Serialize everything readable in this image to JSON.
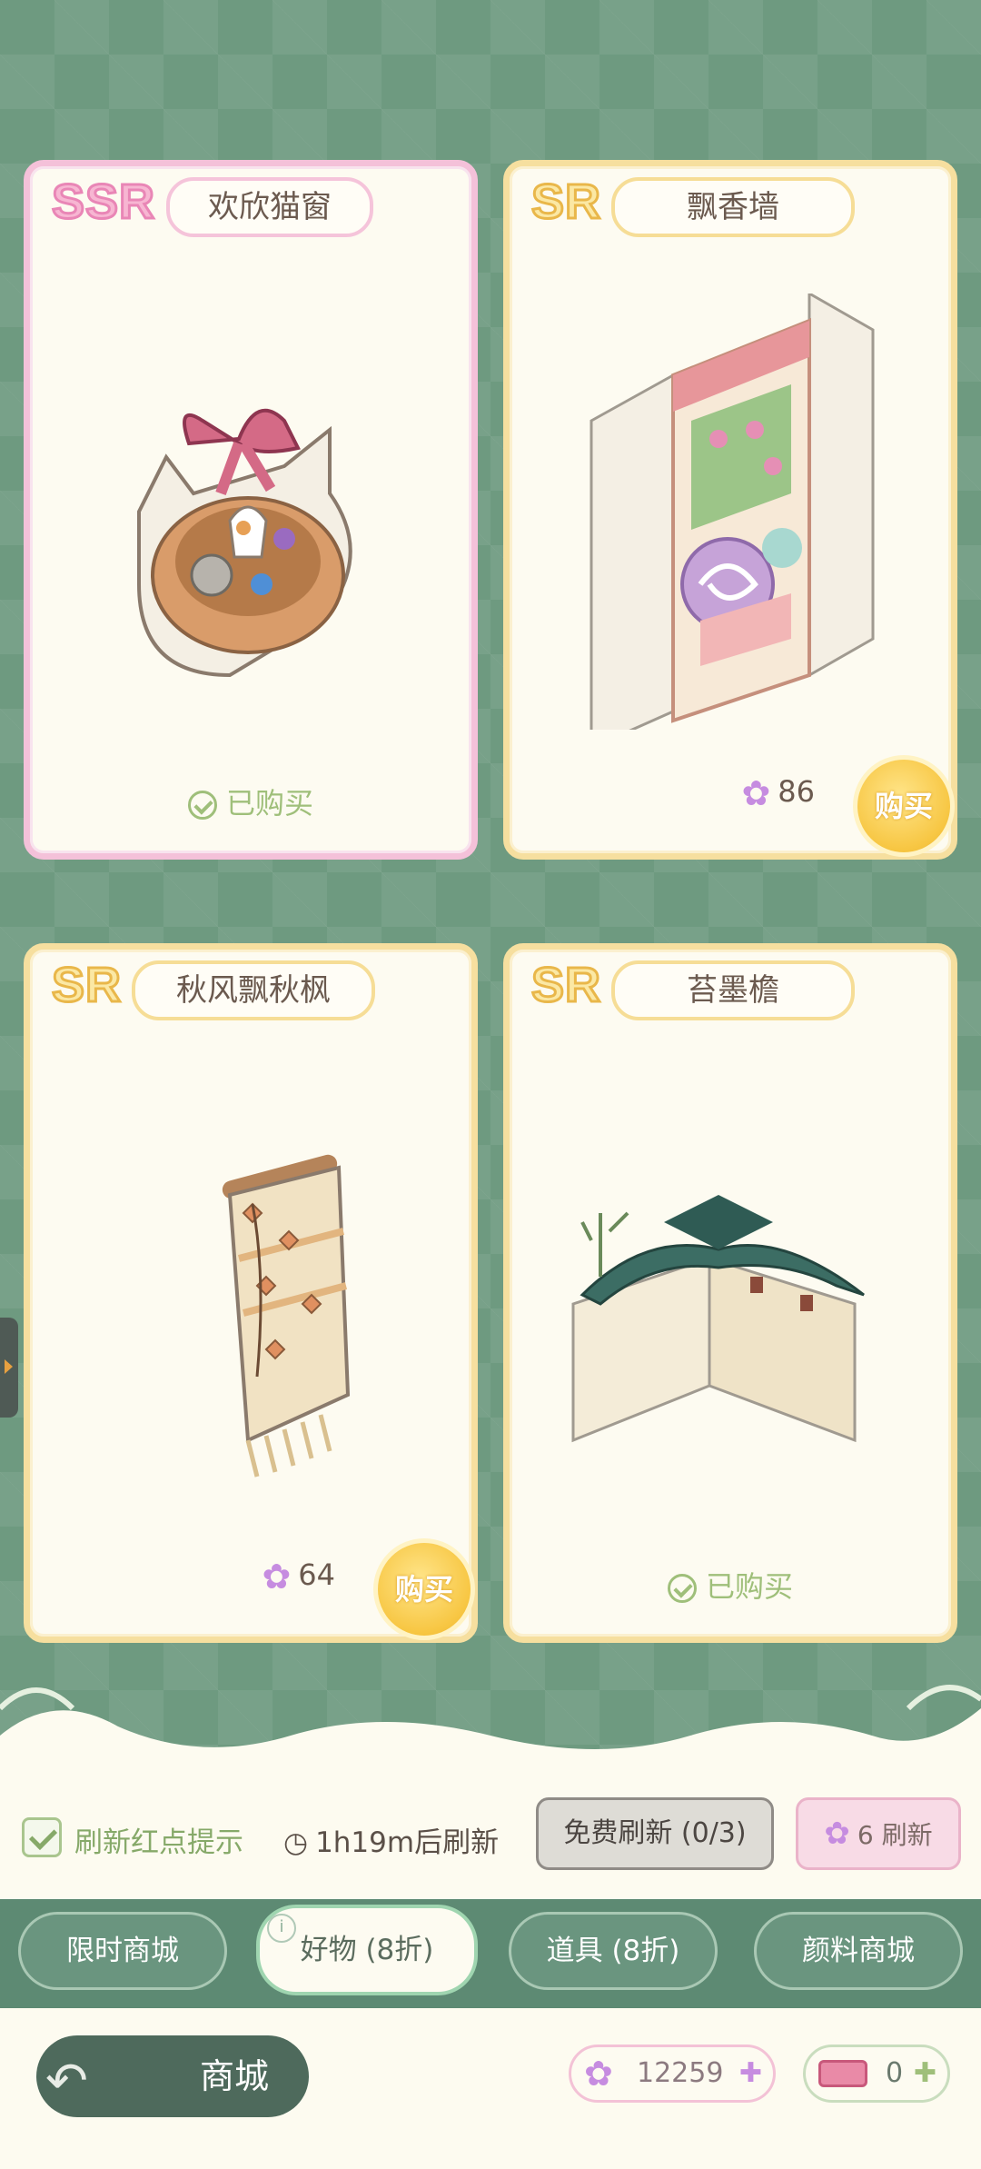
{
  "items": [
    {
      "rarity": "SSR",
      "name": "欢欣猫窗",
      "status": "已购买",
      "price": ""
    },
    {
      "rarity": "SR",
      "name": "飘香墙",
      "status": "",
      "price": "86",
      "buy_label": "购买"
    },
    {
      "rarity": "SR",
      "name": "秋风飘秋枫",
      "status": "",
      "price": "64",
      "buy_label": "购买"
    },
    {
      "rarity": "SR",
      "name": "苔墨檐",
      "status": "已购买",
      "price": ""
    }
  ],
  "refresh": {
    "checkbox_label": "刷新红点提示",
    "timer": "1h19m后刷新",
    "free_button": "免费刷新 (0/3)",
    "paid_cost": "6",
    "paid_label": "刷新"
  },
  "tabs": [
    {
      "label": "限时商城"
    },
    {
      "label": "好物 (8折)",
      "active": true
    },
    {
      "label": "道具 (8折)"
    },
    {
      "label": "颜料商城"
    }
  ],
  "footer": {
    "title": "商城",
    "gems": "12259",
    "tickets": "0"
  },
  "colors": {
    "background": "#6e9a80",
    "ssr_border": "#f4c1d9",
    "sr_border": "#f6df9f",
    "owned_green": "#9fbf7a",
    "buy_gold": "#f7c642"
  }
}
